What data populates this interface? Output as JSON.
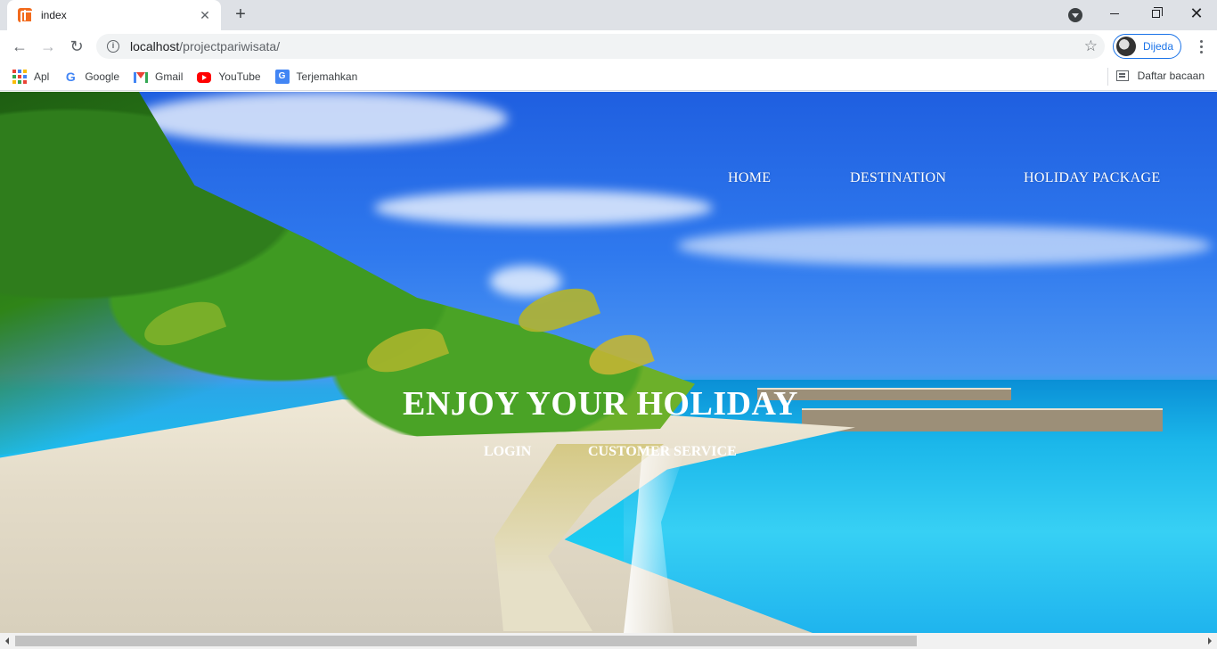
{
  "browser": {
    "tab": {
      "title": "index"
    },
    "address": {
      "host": "localhost",
      "path": "/projectpariwisata/"
    },
    "profile": {
      "label": "Dijeda"
    },
    "bookmarks": [
      {
        "label": "Apl",
        "icon": "apps-icon"
      },
      {
        "label": "Google",
        "icon": "google-icon"
      },
      {
        "label": "Gmail",
        "icon": "gmail-icon"
      },
      {
        "label": "YouTube",
        "icon": "youtube-icon"
      },
      {
        "label": "Terjemahkan",
        "icon": "translate-icon"
      }
    ],
    "reading_list": {
      "label": "Daftar bacaan"
    }
  },
  "site": {
    "nav": [
      {
        "label": "HOME"
      },
      {
        "label": "DESTINATION"
      },
      {
        "label": "HOLIDAY PACKAGE"
      }
    ],
    "headline": "ENJOY YOUR HOLIDAY",
    "links": [
      {
        "label": "LOGIN"
      },
      {
        "label": "CUSTOMER SERVICE"
      }
    ]
  }
}
